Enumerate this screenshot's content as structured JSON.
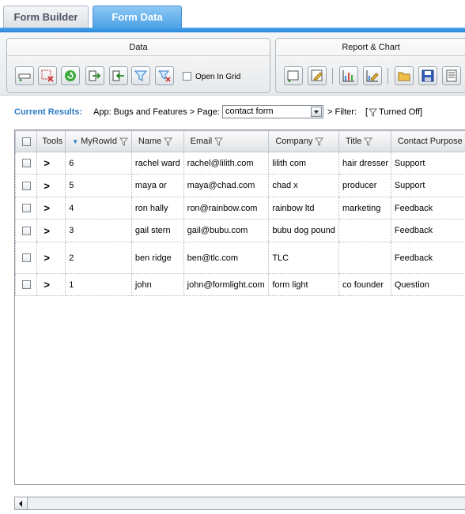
{
  "tabs": {
    "builder": "Form Builder",
    "data": "Form Data"
  },
  "ribbon": {
    "data_panel_title": "Data",
    "report_panel_title": "Report & Chart",
    "open_in_grid_label": "Open In Grid",
    "data_tools": [
      "add-row-icon",
      "delete-rows-icon",
      "refresh-icon",
      "export-icon",
      "import-icon",
      "filter-icon",
      "clear-filter-icon"
    ],
    "report_tools": [
      "new-report-icon",
      "edit-report-icon",
      "chart-icon",
      "edit-chart-icon",
      "open-folder-icon",
      "save-icon",
      "list-icon"
    ]
  },
  "results": {
    "label": "Current Results:",
    "crumb": "App: Bugs and Features > Page:",
    "page_value": "contact form",
    "filter_label": "> Filter:",
    "filter_state": "Turned Off]",
    "filter_bracket": "["
  },
  "grid": {
    "columns": [
      "Tools",
      "MyRowId",
      "Name",
      "Email",
      "Company",
      "Title",
      "Contact Purpose"
    ],
    "rows": [
      {
        "tool": ">",
        "id": "6",
        "name": "rachel ward",
        "email": "rachel@lilith.com",
        "company": "lilith com",
        "title": "hair dresser",
        "purpose": "Support"
      },
      {
        "tool": ">",
        "id": "5",
        "name": "maya or",
        "email": "maya@chad.com",
        "company": "chad x",
        "title": "producer",
        "purpose": "Support"
      },
      {
        "tool": ">",
        "id": "4",
        "name": "ron hally",
        "email": "ron@rainbow.com",
        "company": "rainbow ltd",
        "title": "marketing",
        "purpose": "Feedback"
      },
      {
        "tool": ">",
        "id": "3",
        "name": "gail stern",
        "email": "gail@bubu.com",
        "company": "bubu dog pound",
        "title": "",
        "purpose": "Feedback"
      },
      {
        "tool": ">",
        "id": "2",
        "name": "ben ridge",
        "email": "ben@tlc.com",
        "company": "TLC",
        "title": "",
        "purpose": "Feedback"
      },
      {
        "tool": ">",
        "id": "1",
        "name": "john",
        "email": "john@formlight.com",
        "company": "form light",
        "title": "co founder",
        "purpose": "Question"
      }
    ]
  },
  "colors": {
    "accent": "#2c86d8",
    "label_blue": "#2c7bc3"
  }
}
